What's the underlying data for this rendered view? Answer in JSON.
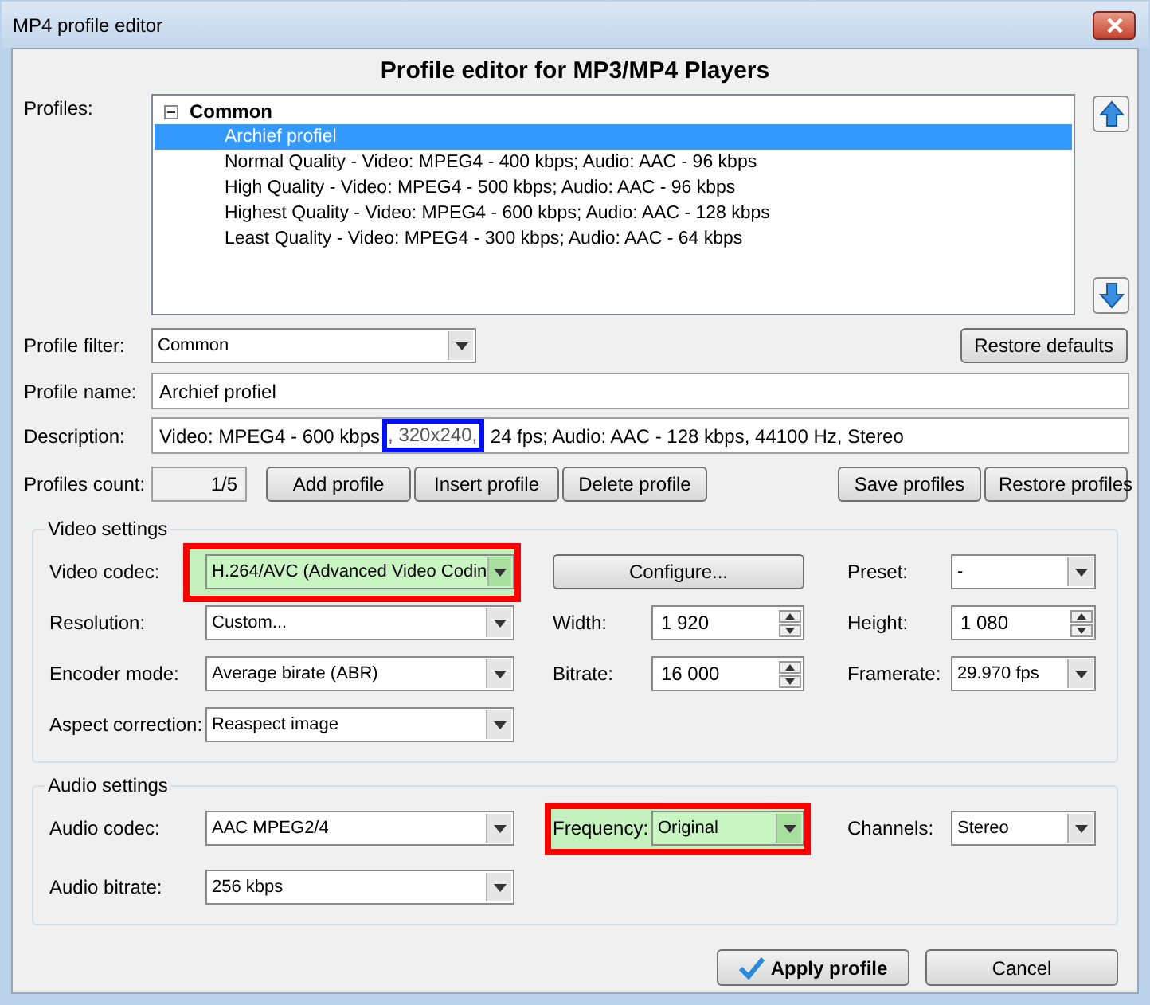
{
  "window": {
    "title": "MP4 profile editor"
  },
  "heading": "Profile editor for MP3/MP4 Players",
  "profiles": {
    "label": "Profiles:",
    "groups": [
      {
        "name": "Common",
        "expanded": true,
        "items": [
          {
            "label": "Archief profiel",
            "selected": true
          },
          {
            "label": "Normal Quality - Video: MPEG4 - 400 kbps; Audio: AAC - 96 kbps",
            "selected": false
          },
          {
            "label": "High Quality - Video: MPEG4 - 500 kbps; Audio: AAC - 96 kbps",
            "selected": false
          },
          {
            "label": "Highest Quality - Video: MPEG4 - 600 kbps; Audio: AAC - 128 kbps",
            "selected": false
          },
          {
            "label": "Least Quality - Video: MPEG4 - 300 kbps; Audio: AAC - 64 kbps",
            "selected": false
          }
        ]
      }
    ]
  },
  "filter": {
    "label": "Profile filter:",
    "value": "Common",
    "button": "Restore defaults"
  },
  "name": {
    "label": "Profile name:",
    "value": "Archief profiel"
  },
  "description": {
    "label": "Description:",
    "parts": [
      {
        "text": "Video: MPEG4 - 600 kbps",
        "marked": false
      },
      {
        "text": ", 320x240,",
        "marked": true
      },
      {
        "text": " 24 fps; Audio: AAC - 128 kbps, 44100 Hz, Stereo",
        "marked": false
      }
    ]
  },
  "count": {
    "label": "Profiles count:",
    "value": "1/5"
  },
  "profile_buttons": [
    "Add profile",
    "Insert profile",
    "Delete profile"
  ],
  "store_buttons": [
    "Save profiles",
    "Restore profiles"
  ],
  "video_settings": {
    "title": "Video settings",
    "rows": [
      [
        {
          "kind": "combo",
          "label": "Video codec:",
          "value": "H.264/AVC (Advanced Video Codin",
          "highlighted": true
        },
        {
          "kind": "button",
          "value": "Configure..."
        },
        {
          "kind": "combo",
          "label": "Preset:",
          "value": "-"
        }
      ],
      [
        {
          "kind": "combo",
          "label": "Resolution:",
          "value": "Custom..."
        },
        {
          "kind": "spin",
          "label": "Width:",
          "value": "1 920"
        },
        {
          "kind": "spin",
          "label": "Height:",
          "value": "1 080"
        }
      ],
      [
        {
          "kind": "combo",
          "label": "Encoder mode:",
          "value": "Average birate (ABR)"
        },
        {
          "kind": "spin",
          "label": "Bitrate:",
          "value": "16 000"
        },
        {
          "kind": "combo",
          "label": "Framerate:",
          "value": "29.970 fps"
        }
      ],
      [
        {
          "kind": "combo",
          "label": "Aspect correction:",
          "value": "Reaspect image"
        }
      ]
    ]
  },
  "audio_settings": {
    "title": "Audio settings",
    "rows": [
      [
        {
          "kind": "combo",
          "label": "Audio codec:",
          "value": "AAC MPEG2/4"
        },
        {
          "kind": "combo",
          "label": "Frequency:",
          "value": "Original",
          "highlighted": true
        },
        {
          "kind": "combo",
          "label": "Channels:",
          "value": "Stereo"
        }
      ],
      [
        {
          "kind": "combo",
          "label": "Audio bitrate:",
          "value": "256 kbps"
        }
      ]
    ]
  },
  "footer_buttons": [
    {
      "label": "Apply profile",
      "kind": "primary"
    },
    {
      "label": "Cancel",
      "kind": "plain"
    }
  ]
}
